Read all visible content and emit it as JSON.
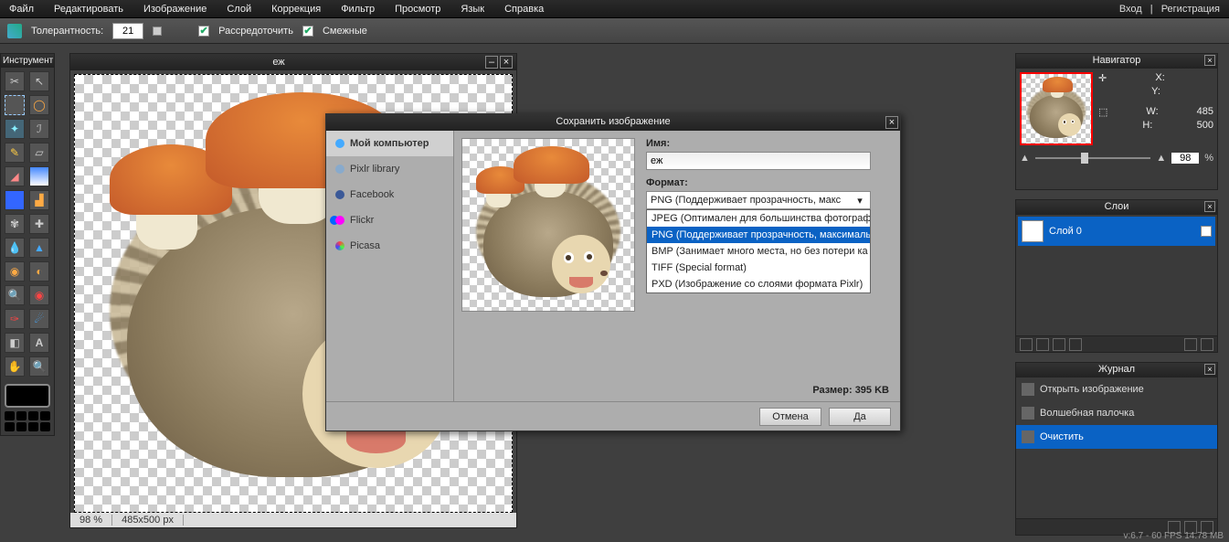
{
  "menu": {
    "file": "Файл",
    "edit": "Редактировать",
    "image": "Изображение",
    "layer": "Слой",
    "adjust": "Коррекция",
    "filter": "Фильтр",
    "view": "Просмотр",
    "lang": "Язык",
    "help": "Справка",
    "login": "Вход",
    "sep": "|",
    "register": "Регистрация"
  },
  "options": {
    "tolerance_label": "Толерантность:",
    "tolerance_value": "21",
    "antialias": "Рассредоточить",
    "contiguous": "Смежные"
  },
  "toolbox": {
    "title": "Инструмент"
  },
  "document": {
    "title": "еж",
    "zoom": "98  %",
    "dims": "485x500 px"
  },
  "navigator": {
    "title": "Навигатор",
    "x": "X:",
    "y": "Y:",
    "w": "W:",
    "h": "H:",
    "wv": "485",
    "hv": "500",
    "zoom": "98",
    "pct": "%"
  },
  "layers": {
    "title": "Слои",
    "layer0": "Слой 0"
  },
  "history": {
    "title": "Журнал",
    "open": "Открыть изображение",
    "wand": "Волшебная палочка",
    "clear": "Очистить"
  },
  "dialog": {
    "title": "Сохранить изображение",
    "dest": {
      "mycomp": "Мой компьютер",
      "pixlr": "Pixlr library",
      "facebook": "Facebook",
      "flickr": "Flickr",
      "picasa": "Picasa"
    },
    "name_label": "Имя:",
    "name_value": "еж",
    "format_label": "Формат:",
    "format_selected": "PNG (Поддерживает прозрачность, макс",
    "formats": {
      "jpeg": "JPEG (Оптимален для большинства фотографи",
      "png": "PNG (Поддерживает прозрачность, максималь",
      "bmp": "BMP (Занимает много места, но без потери ка",
      "tiff": "TIFF (Special format)",
      "pxd": "PXD (Изображение со слоями формата Pixlr)"
    },
    "size": "Размер: 395 KB",
    "cancel": "Отмена",
    "ok": "Да"
  },
  "status": "v:6.7 - 60 FPS 14.78 MB"
}
